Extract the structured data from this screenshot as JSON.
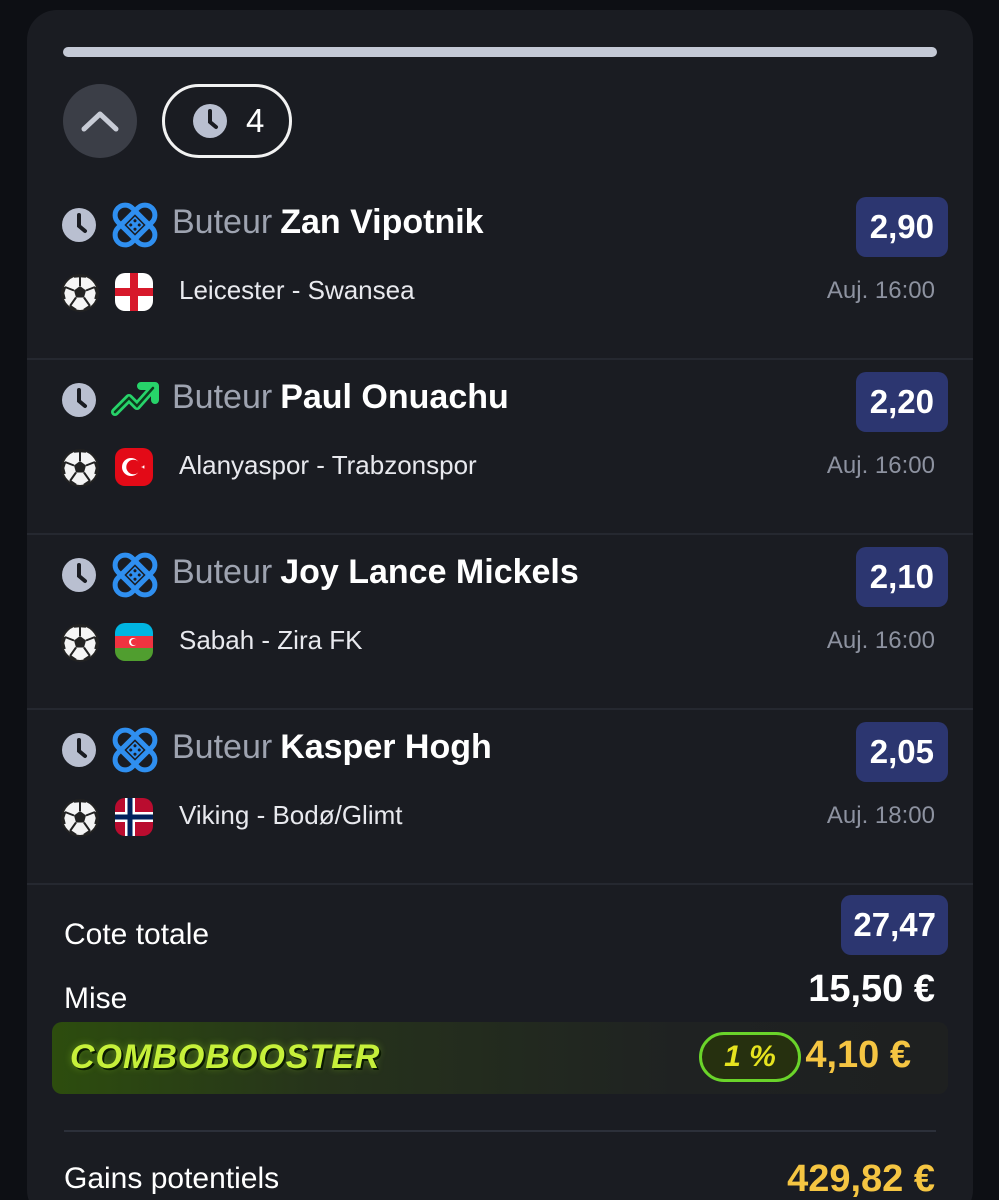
{
  "header": {
    "pending_count": "4"
  },
  "bets": [
    {
      "type": "Buteur",
      "player": "Zan Vipotnik",
      "odds": "2,90",
      "match": "Leicester - Swansea",
      "time": "Auj. 16:00",
      "flag": "england-flag",
      "market_icon": "shield-icon",
      "market_color": "#2f8ff0"
    },
    {
      "type": "Buteur",
      "player": "Paul Onuachu",
      "odds": "2,20",
      "match": "Alanyaspor - Trabzonspor",
      "time": "Auj. 16:00",
      "flag": "turkey-flag",
      "market_icon": "trend-up-icon",
      "market_color": "#27d36a"
    },
    {
      "type": "Buteur",
      "player": "Joy Lance Mickels",
      "odds": "2,10",
      "match": "Sabah - Zira FK",
      "time": "Auj. 16:00",
      "flag": "azerbaijan-flag",
      "market_icon": "shield-icon",
      "market_color": "#2f8ff0"
    },
    {
      "type": "Buteur",
      "player": "Kasper Hogh",
      "odds": "2,05",
      "match": "Viking - Bodø/Glimt",
      "time": "Auj. 18:00",
      "flag": "norway-flag",
      "market_icon": "shield-icon",
      "market_color": "#2f8ff0"
    }
  ],
  "summary": {
    "total_odds_label": "Cote totale",
    "total_odds": "27,47",
    "stake_label": "Mise",
    "stake": "15,50 €",
    "booster_label": "COMBOBOOSTER",
    "booster_percent": "1 %",
    "booster_amount": "4,10 €",
    "gains_label": "Gains potentiels",
    "gains": "429,82 €"
  },
  "colors": {
    "odds_badge": "#2c3670",
    "highlight_amount": "#f5c542",
    "booster_green": "#6ad42a"
  }
}
